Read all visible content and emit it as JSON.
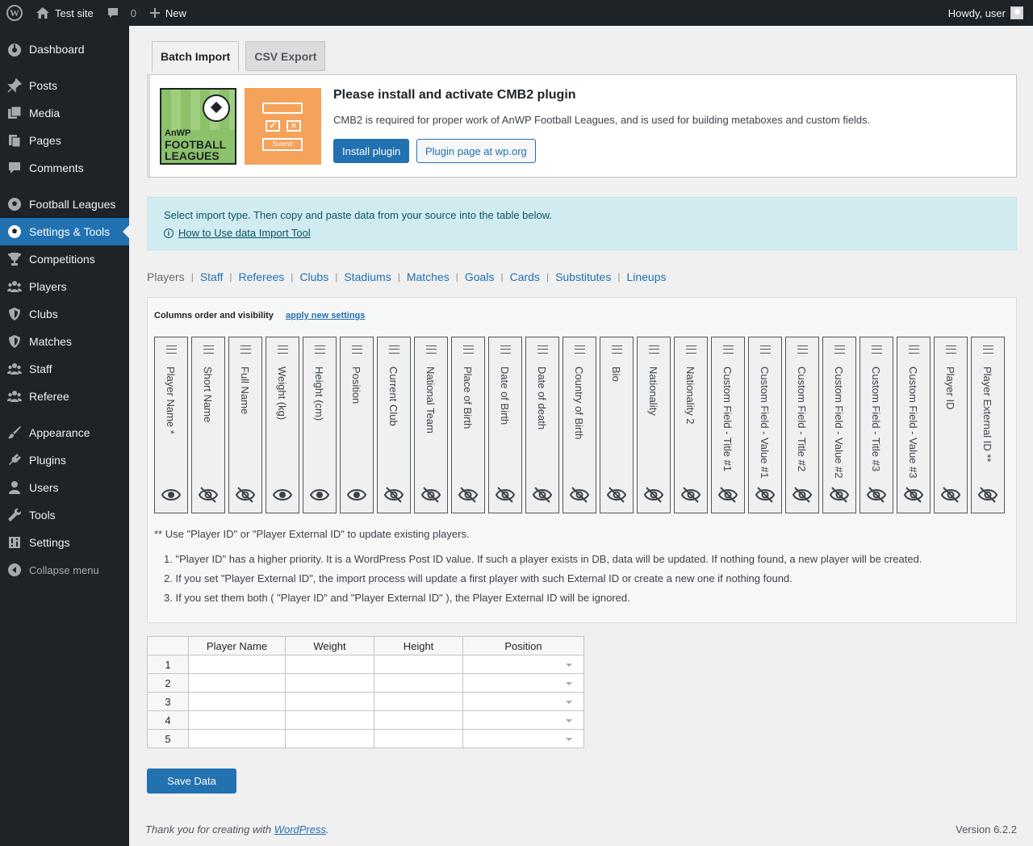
{
  "adminbar": {
    "site_name": "Test site",
    "comments_count": "0",
    "new_label": "New",
    "howdy": "Howdy, user"
  },
  "sidebar": {
    "items": [
      {
        "label": "Dashboard",
        "icon": "dashboard-icon"
      },
      {
        "label": "Posts",
        "icon": "pin-icon"
      },
      {
        "label": "Media",
        "icon": "media-icon"
      },
      {
        "label": "Pages",
        "icon": "pages-icon"
      },
      {
        "label": "Comments",
        "icon": "comment-icon"
      },
      {
        "label": "Football Leagues",
        "icon": "soccer-ball-icon"
      },
      {
        "label": "Settings & Tools",
        "icon": "soccer-ball-icon"
      },
      {
        "label": "Competitions",
        "icon": "trophy-icon"
      },
      {
        "label": "Players",
        "icon": "people-icon"
      },
      {
        "label": "Clubs",
        "icon": "shield-icon"
      },
      {
        "label": "Matches",
        "icon": "shield-icon"
      },
      {
        "label": "Staff",
        "icon": "people-icon"
      },
      {
        "label": "Referee",
        "icon": "people-icon"
      },
      {
        "label": "Appearance",
        "icon": "brush-icon"
      },
      {
        "label": "Plugins",
        "icon": "plugin-icon"
      },
      {
        "label": "Users",
        "icon": "user-icon"
      },
      {
        "label": "Tools",
        "icon": "wrench-icon"
      },
      {
        "label": "Settings",
        "icon": "settings-icon"
      }
    ],
    "collapse_label": "Collapse menu"
  },
  "tabs": [
    "Batch Import",
    "CSV Export"
  ],
  "notice": {
    "logo_text": [
      "AnWP",
      "FOOTBALL",
      "LEAGUES"
    ],
    "submit_text": "Submit",
    "title": "Please install and activate CMB2 plugin",
    "text": "CMB2 is required for proper work of AnWP Football Leagues, and is used for building metaboxes and custom fields.",
    "install_label": "Install plugin",
    "plugin_page_label": "Plugin page at wp.org"
  },
  "info": {
    "text": "Select import type. Then copy and paste data from your source into the table below.",
    "link": "How to Use data Import Tool"
  },
  "import_types": [
    "Players",
    "Staff",
    "Referees",
    "Clubs",
    "Stadiums",
    "Matches",
    "Goals",
    "Cards",
    "Substitutes",
    "Lineups"
  ],
  "columns_settings": {
    "title": "Columns order and visibility",
    "apply_label": "apply new settings",
    "columns": [
      {
        "label": "Player Name *",
        "visible": true
      },
      {
        "label": "Short Name",
        "visible": false
      },
      {
        "label": "Full Name",
        "visible": false
      },
      {
        "label": "Weight (kg)",
        "visible": true
      },
      {
        "label": "Height (cm)",
        "visible": true
      },
      {
        "label": "Position",
        "visible": true
      },
      {
        "label": "Current Club",
        "visible": false
      },
      {
        "label": "National Team",
        "visible": false
      },
      {
        "label": "Place of Birth",
        "visible": false
      },
      {
        "label": "Date of Birth",
        "visible": false
      },
      {
        "label": "Date of death",
        "visible": false
      },
      {
        "label": "Country of Birth",
        "visible": false
      },
      {
        "label": "Bio",
        "visible": false
      },
      {
        "label": "Nationality",
        "visible": false
      },
      {
        "label": "Nationality 2",
        "visible": false
      },
      {
        "label": "Custom Field - Title #1",
        "visible": false
      },
      {
        "label": "Custom Field - Value #1",
        "visible": false
      },
      {
        "label": "Custom Field - Title #2",
        "visible": false
      },
      {
        "label": "Custom Field - Value #2",
        "visible": false
      },
      {
        "label": "Custom Field - Title #3",
        "visible": false
      },
      {
        "label": "Custom Field - Value #3",
        "visible": false
      },
      {
        "label": "Player ID",
        "visible": false
      },
      {
        "label": "Player External ID **",
        "visible": false
      }
    ],
    "note": "** Use \"Player ID\" or \"Player External ID\" to update existing players.",
    "list": [
      "1. \"Player ID\" has a higher priority. It is a WordPress Post ID value. If such a player exists in DB, data will be updated. If nothing found, a new player will be created.",
      "2. If you set \"Player External ID\", the import process will update a first player with such External ID or create a new one if nothing found.",
      "3. If you set them both ( \"Player ID\" and \"Player External ID\" ), the Player External ID will be ignored."
    ]
  },
  "table": {
    "headers": [
      "Player Name",
      "Weight",
      "Height",
      "Position"
    ],
    "rows": [
      "1",
      "2",
      "3",
      "4",
      "5"
    ]
  },
  "save_label": "Save Data",
  "footer": {
    "thanks_prefix": "Thank you for creating with ",
    "thanks_link": "WordPress",
    "thanks_suffix": ".",
    "version": "Version 6.2.2"
  }
}
